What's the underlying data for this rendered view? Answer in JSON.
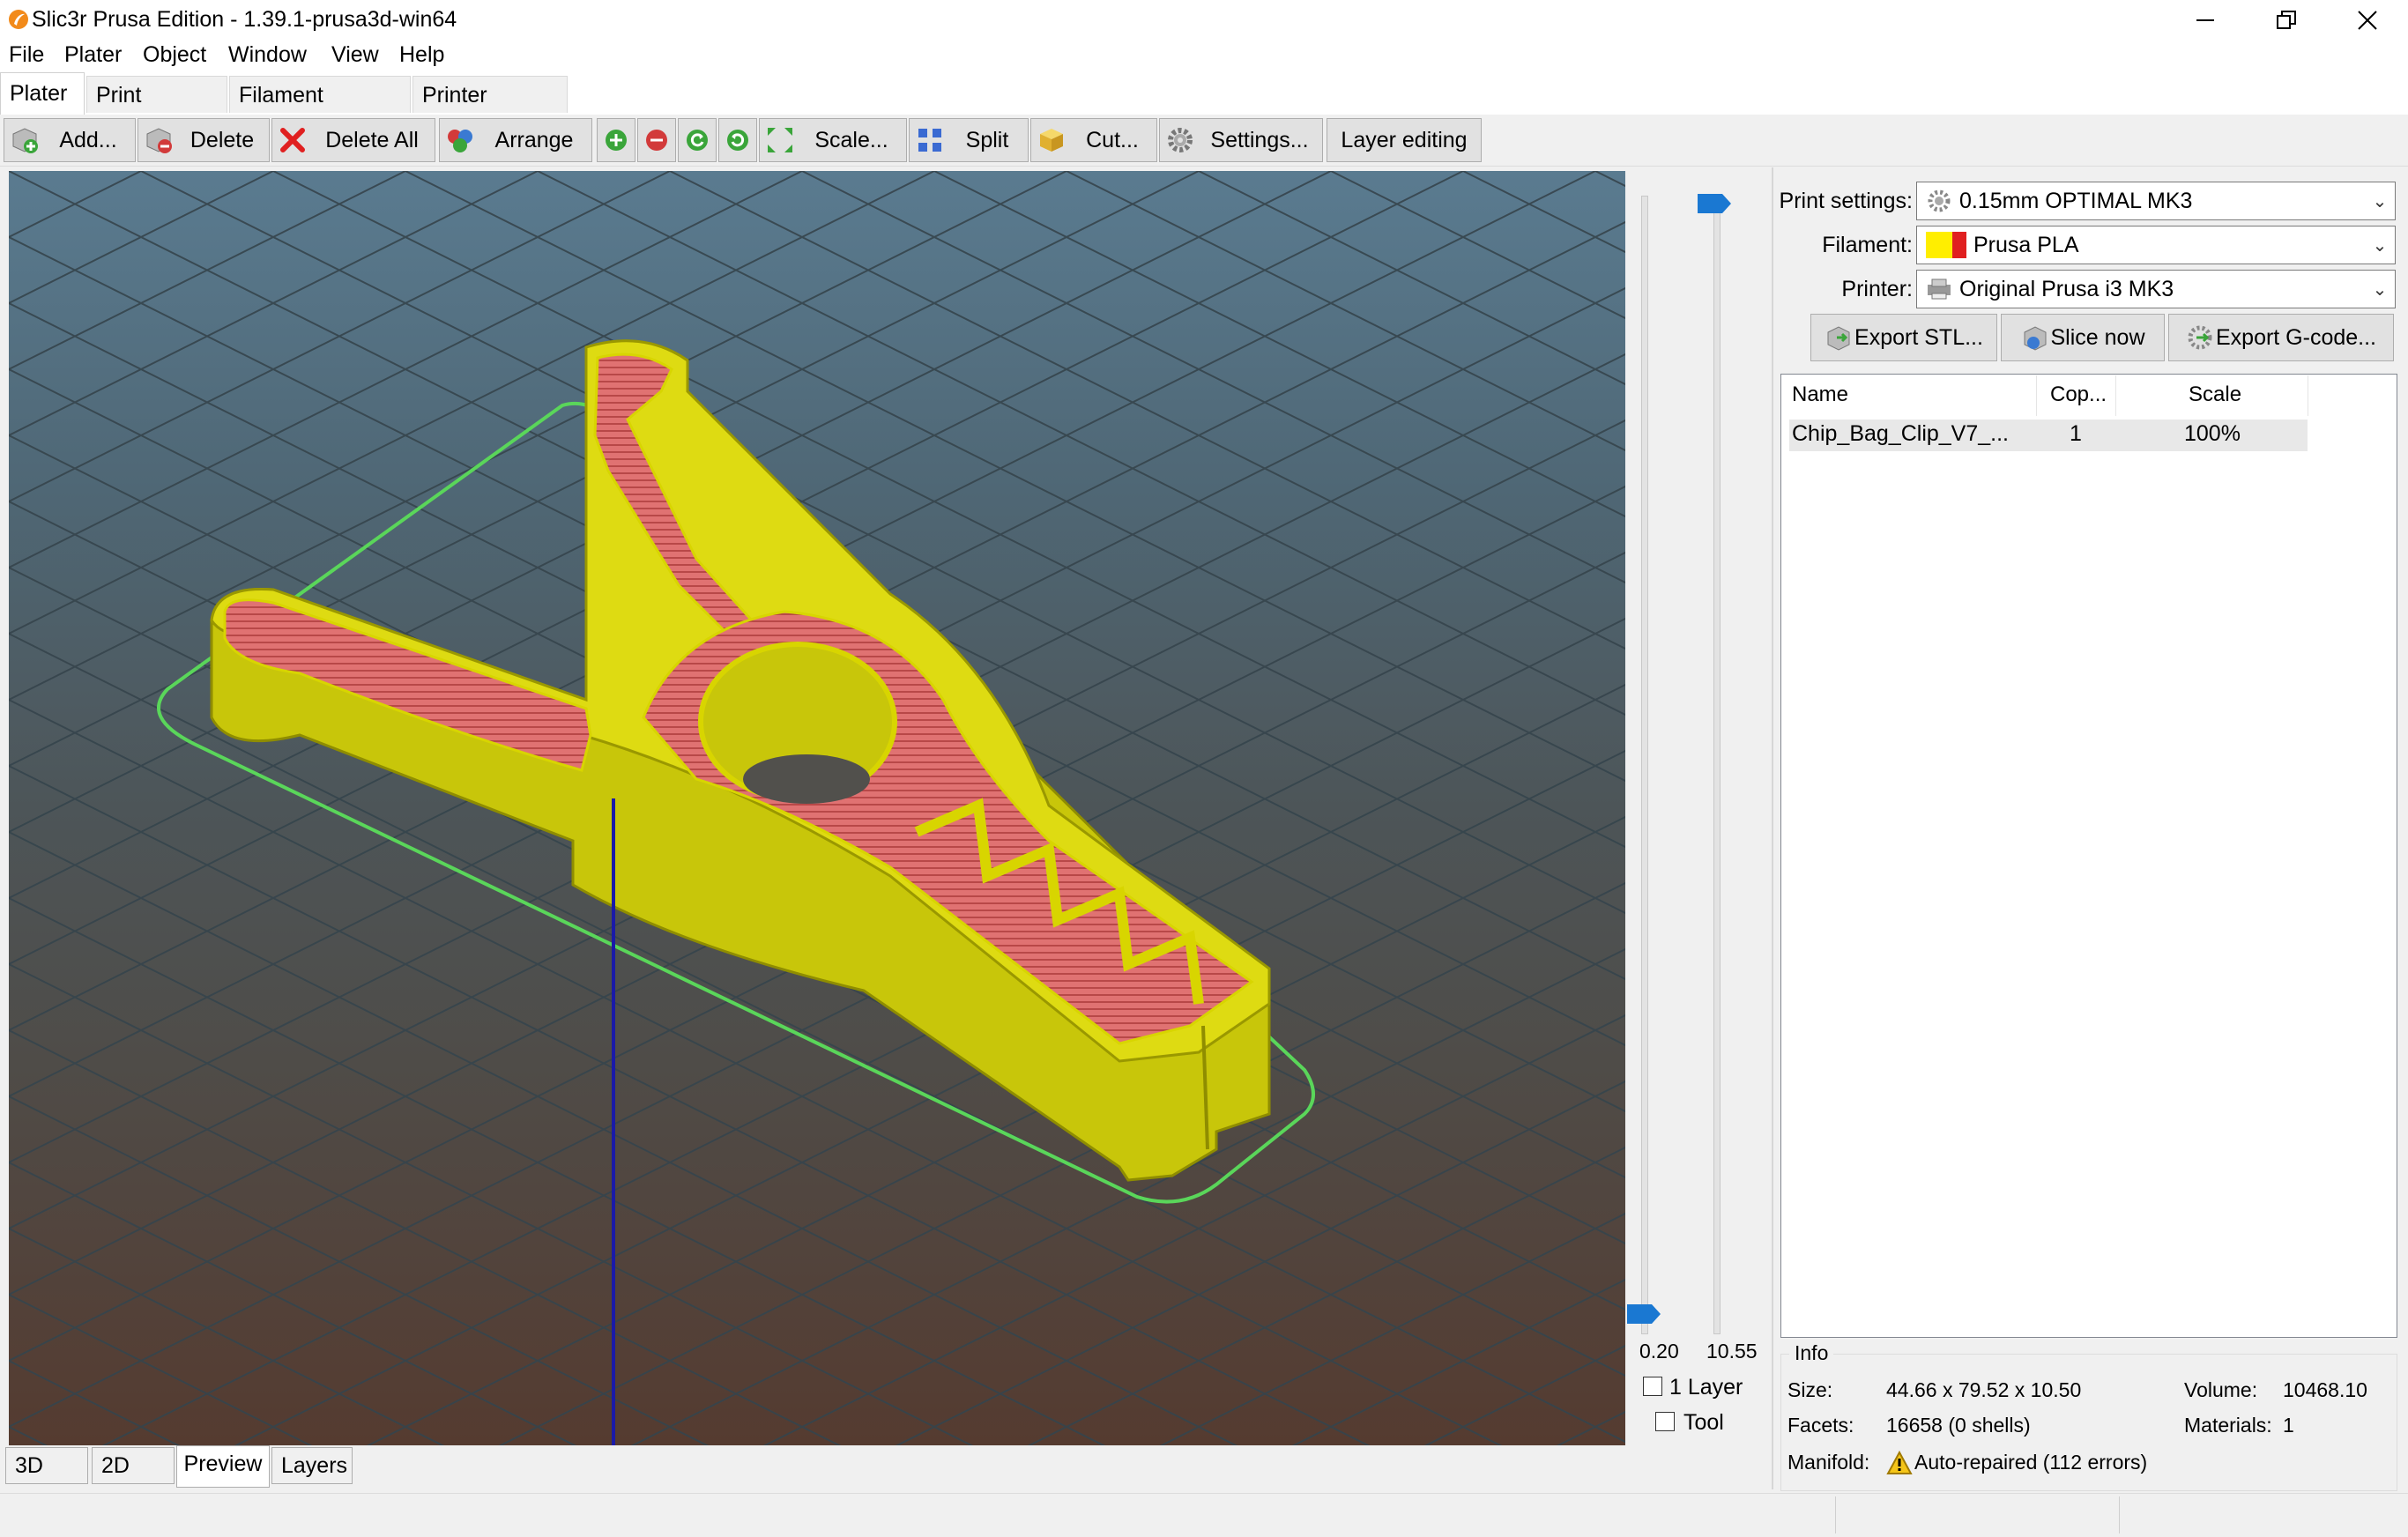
{
  "window": {
    "title": "Slic3r Prusa Edition - 1.39.1-prusa3d-win64"
  },
  "menu": [
    "File",
    "Plater",
    "Object",
    "Window",
    "View",
    "Help"
  ],
  "tabs": [
    "Plater",
    "Print Settings",
    "Filament Settings",
    "Printer Settings"
  ],
  "toolbar": {
    "add": "Add...",
    "delete": "Delete",
    "delete_all": "Delete All",
    "arrange": "Arrange",
    "scale": "Scale...",
    "split": "Split",
    "cut": "Cut...",
    "settings": "Settings...",
    "layer_editing": "Layer editing"
  },
  "slider": {
    "min_value": "0.20",
    "max_value": "10.55",
    "one_layer": "1 Layer",
    "tool": "Tool"
  },
  "view_tabs": [
    "3D",
    "2D",
    "Preview",
    "Layers"
  ],
  "settings": {
    "print_label": "Print settings:",
    "print_value": "0.15mm OPTIMAL MK3",
    "filament_label": "Filament:",
    "filament_value": "Prusa PLA",
    "printer_label": "Printer:",
    "printer_value": "Original Prusa i3 MK3"
  },
  "actions": {
    "export_stl": "Export STL...",
    "slice_now": "Slice now",
    "export_gcode": "Export G-code..."
  },
  "object_list": {
    "columns": [
      "Name",
      "Cop...",
      "Scale"
    ],
    "rows": [
      {
        "name": "Chip_Bag_Clip_V7_...",
        "copies": "1",
        "scale": "100%"
      }
    ]
  },
  "info": {
    "heading": "Info",
    "size_label": "Size:",
    "size_value": "44.66 x 79.52 x 10.50",
    "volume_label": "Volume:",
    "volume_value": "10468.10",
    "facets_label": "Facets:",
    "facets_value": "16658 (0 shells)",
    "materials_label": "Materials:",
    "materials_value": "1",
    "manifold_label": "Manifold:",
    "manifold_value": "Auto-repaired (112 errors)"
  },
  "colors": {
    "model_wall": "#d4d20a",
    "model_infill": "#e06b6b",
    "bed_outline": "#5ad65a",
    "slider_handle": "#1a78d2"
  }
}
